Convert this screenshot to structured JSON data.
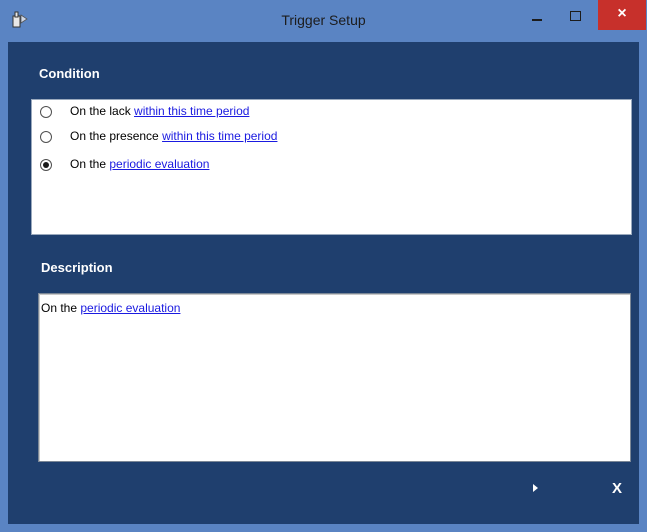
{
  "window": {
    "title": "Trigger Setup",
    "close_glyph": "×",
    "app_icon": "trigger-app-icon",
    "colors": {
      "frame": "#5a84c3",
      "client": "#1f3f6e",
      "close": "#c7302b",
      "link": "#1a1ae0"
    }
  },
  "condition": {
    "label": "Condition",
    "options": [
      {
        "prefix": "On the lack ",
        "link": "within this time period",
        "checked": false
      },
      {
        "prefix": "On the presence ",
        "link": "within this time period",
        "checked": false
      },
      {
        "prefix": "On the ",
        "link": "periodic evaluation",
        "checked": true
      }
    ]
  },
  "description": {
    "label": "Description",
    "prefix": "On the ",
    "link": "periodic evaluation"
  },
  "footer": {
    "next_icon": "play-icon",
    "cancel_label": "X"
  }
}
